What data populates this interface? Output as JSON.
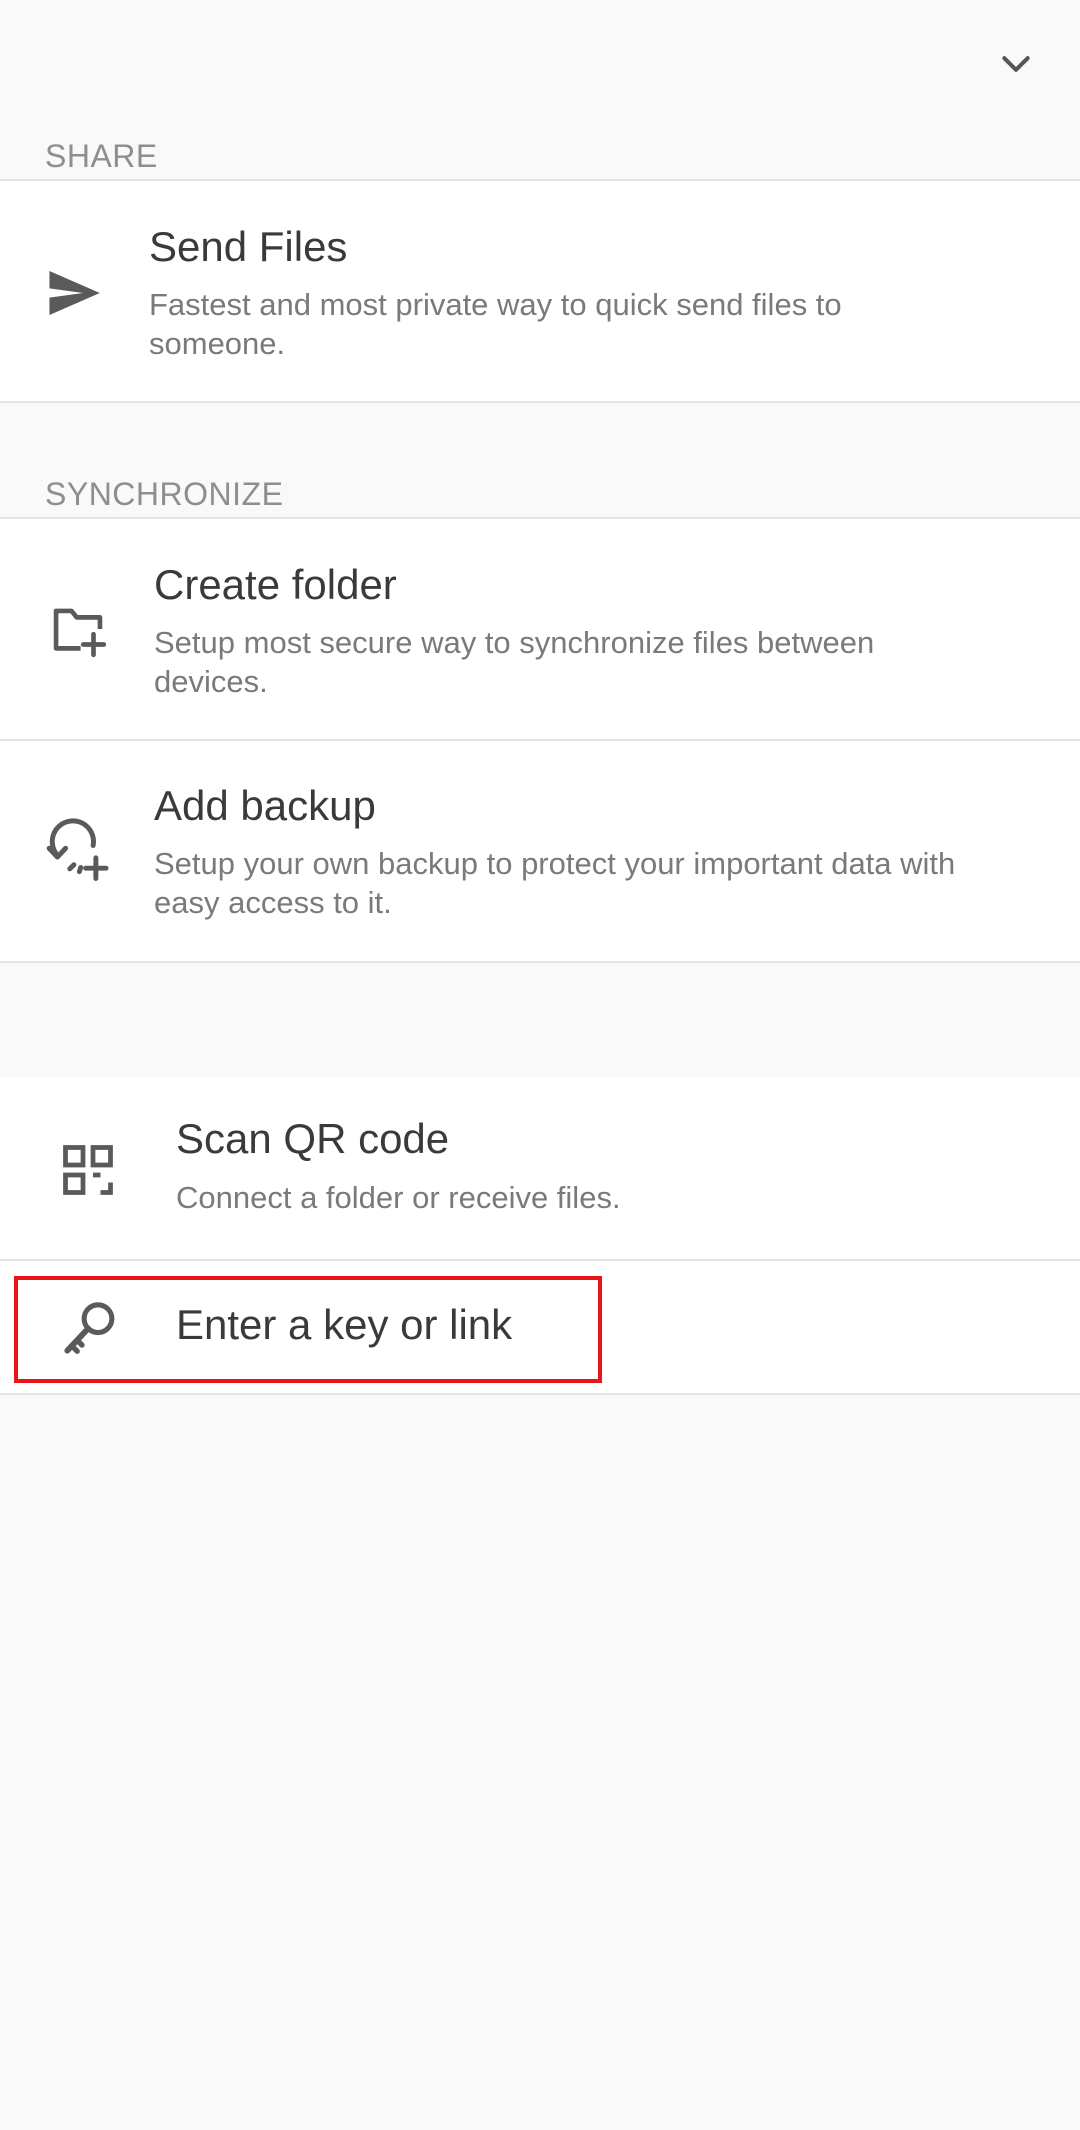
{
  "header": {
    "collapse_icon": "chevron-down-icon"
  },
  "sections": {
    "share": {
      "label": "SHARE",
      "items": [
        {
          "icon": "send-icon",
          "title": "Send Files",
          "description": "Fastest and most private way to quick send files to someone."
        }
      ]
    },
    "synchronize": {
      "label": "SYNCHRONIZE",
      "items": [
        {
          "icon": "create-folder-icon",
          "title": "Create folder",
          "description": "Setup most secure way to synchronize files between devices."
        },
        {
          "icon": "add-backup-icon",
          "title": "Add backup",
          "description": "Setup your own backup to protect your important data with easy access to it."
        }
      ]
    },
    "connect": {
      "items": [
        {
          "icon": "qr-code-icon",
          "title": "Scan QR code",
          "description": "Connect a folder or receive files."
        },
        {
          "icon": "key-icon",
          "title": "Enter a key or link"
        }
      ]
    }
  },
  "colors": {
    "background": "#f9f9f9",
    "row_background": "#ffffff",
    "divider": "#e3e3e3",
    "icon": "#5a5a5a",
    "highlight": "#e8141c"
  }
}
